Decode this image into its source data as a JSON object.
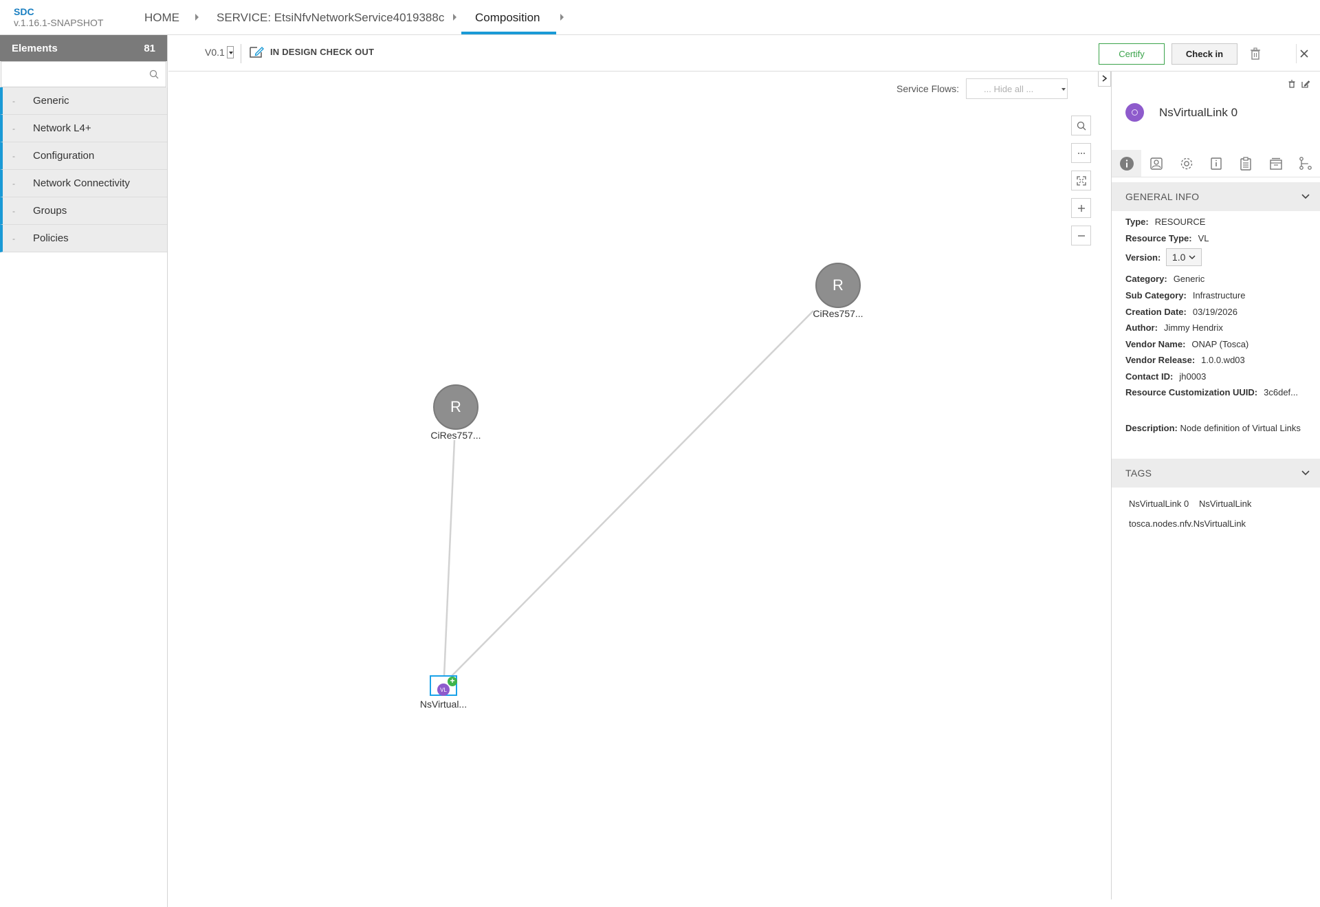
{
  "brand": {
    "name": "SDC",
    "version": "v.1.16.1-SNAPSHOT"
  },
  "breadcrumb": {
    "home": "HOME",
    "service": "SERVICE: EtsiNfvNetworkService4019388c",
    "current": "Composition"
  },
  "palette": {
    "title": "Elements",
    "count": "81",
    "search_placeholder": "",
    "categories": [
      {
        "dash": "-",
        "label": "Generic"
      },
      {
        "dash": "-",
        "label": "Network L4+"
      },
      {
        "dash": "-",
        "label": "Configuration"
      },
      {
        "dash": "-",
        "label": "Network Connectivity"
      },
      {
        "dash": "-",
        "label": "Groups"
      },
      {
        "dash": "-",
        "label": "Policies"
      }
    ]
  },
  "toolbar": {
    "version": "V0.1",
    "status": "IN DESIGN CHECK OUT",
    "certify_label": "Certify",
    "checkin_label": "Check in",
    "icons": [
      "checkout-edit-icon",
      "trash-icon",
      "close-icon"
    ]
  },
  "canvas": {
    "service_flows_label": "Service Flows:",
    "service_flows_value": "... Hide all ...",
    "zoom_controls": [
      "search-icon",
      "more-icon",
      "fit-to-screen-icon",
      "zoom-in-icon",
      "zoom-out-icon"
    ],
    "nodes": {
      "cires_1": {
        "glyph": "R",
        "label": "CiRes757..."
      },
      "cires_2": {
        "glyph": "R",
        "label": "CiRes757..."
      },
      "nsvirtual": {
        "glyph": "VL",
        "plus": "+",
        "label": "NsVirtual..."
      }
    }
  },
  "details": {
    "title": "NsVirtualLink 0",
    "tabs": [
      "info-icon",
      "composition-icon",
      "settings-icon",
      "details-icon",
      "clipboard-icon",
      "artifacts-icon",
      "relations-icon"
    ],
    "general_info_header": "GENERAL INFO",
    "type_label": "Type:",
    "type": "RESOURCE",
    "resource_type_label": "Resource Type:",
    "resource_type": "VL",
    "version_label": "Version:",
    "version": "1.0",
    "category_label": "Category:",
    "category": "Generic",
    "sub_category_label": "Sub Category:",
    "sub_category": "Infrastructure",
    "creation_date_label": "Creation Date:",
    "creation_date": "03/19/2026",
    "author_label": "Author:",
    "author": "Jimmy Hendrix",
    "vendor_name_label": "Vendor Name:",
    "vendor_name": "ONAP (Tosca)",
    "vendor_release_label": "Vendor Release:",
    "vendor_release": "1.0.0.wd03",
    "contact_id_label": "Contact ID:",
    "contact_id": "jh0003",
    "uuid_label": "Resource Customization UUID:",
    "uuid": "3c6def...",
    "description_label": "Description:",
    "description": "Node definition of Virtual Links",
    "tags_header": "TAGS",
    "tags": [
      "NsVirtualLink 0",
      "NsVirtualLink",
      "tosca.nodes.nfv.NsVirtualLink"
    ]
  },
  "colors": {
    "accent": "#1a9ad6",
    "certify": "#3aa34a",
    "vl_node": "#8e5bcc",
    "resource_node": "#8e8e8e",
    "palette_header": "#7a7a7a"
  }
}
